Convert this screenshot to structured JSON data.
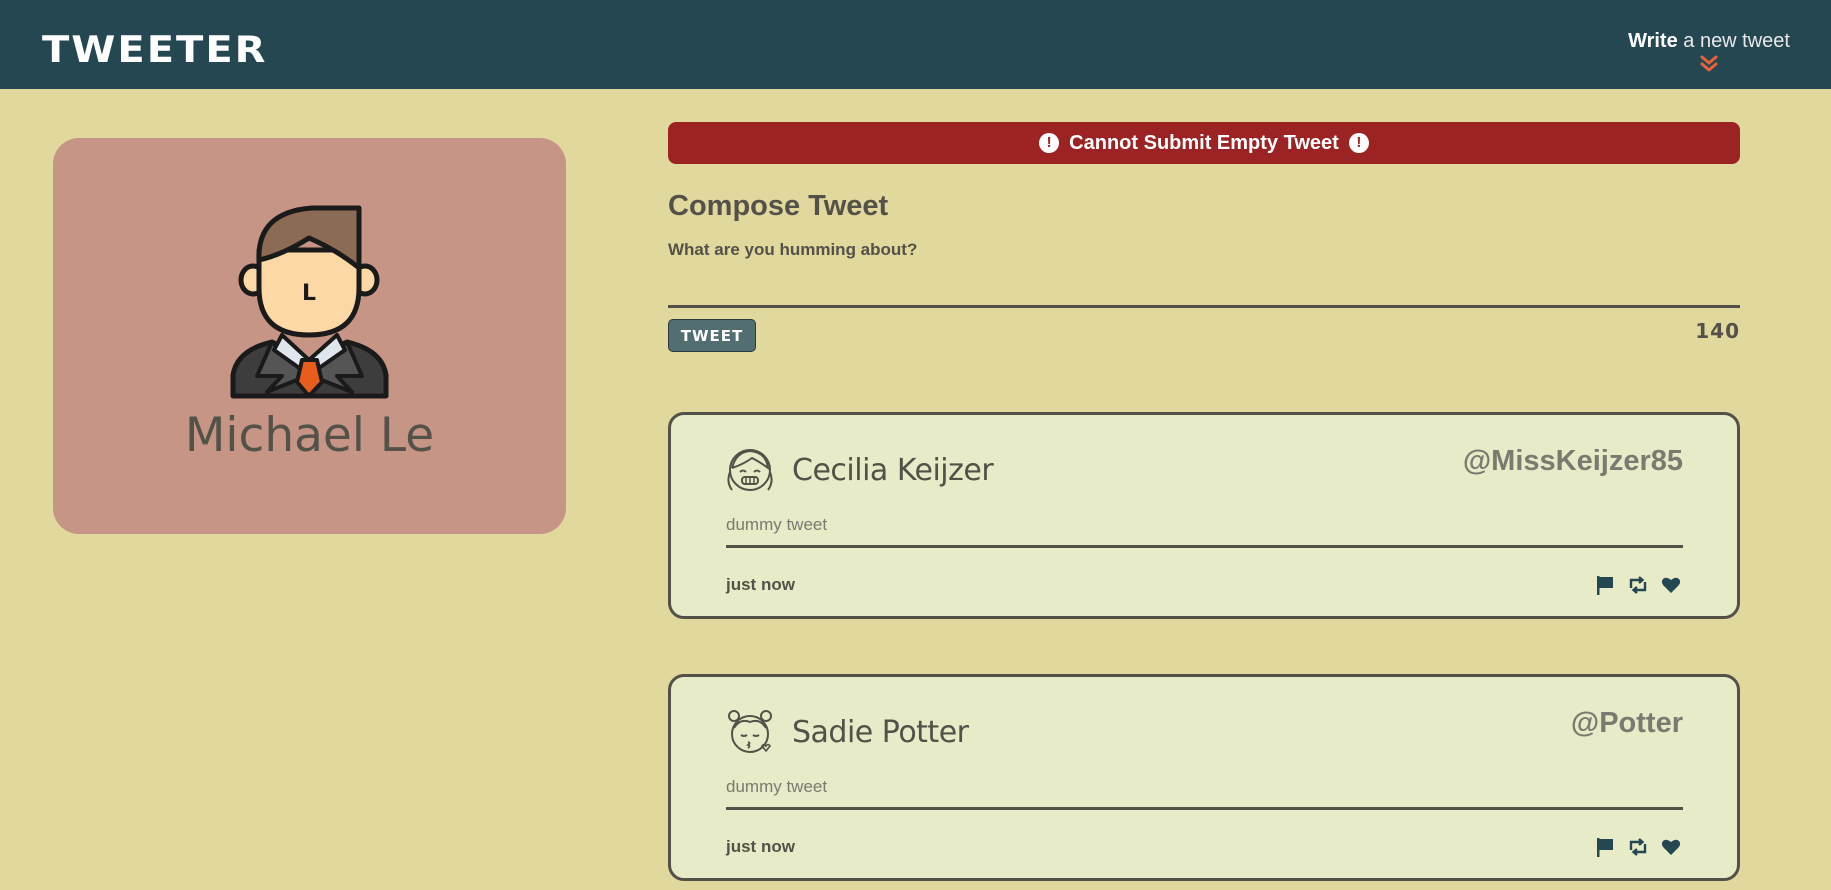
{
  "nav": {
    "brand": "TWEETER",
    "write_bold": "Write",
    "write_rest": " a new tweet",
    "write_icon": "double-chevron-down-icon",
    "accent": "#e8613a"
  },
  "profile": {
    "name": "Michael Le",
    "avatar_icon": "businessman-avatar-icon",
    "avatar_initial": "L",
    "background": "#c69586"
  },
  "error": {
    "message": "Cannot Submit Empty Tweet",
    "icon": "exclamation-circle-icon",
    "icon_glyph": "!",
    "background": "#9c2323"
  },
  "compose": {
    "title": "Compose Tweet",
    "label": "What are you humming about?",
    "input_value": "",
    "button": "TWEET",
    "counter": "140"
  },
  "tweets": [
    {
      "name": "Cecilia Keijzer",
      "handle": "@MissKeijzer85",
      "text": "dummy tweet",
      "time": "just now",
      "avatar_icon": "girl-braces-avatar-icon"
    },
    {
      "name": "Sadie Potter",
      "handle": "@Potter",
      "text": "dummy tweet",
      "time": "just now",
      "avatar_icon": "girl-kiss-avatar-icon"
    }
  ],
  "actions": [
    "flag-icon",
    "retweet-icon",
    "heart-icon"
  ]
}
